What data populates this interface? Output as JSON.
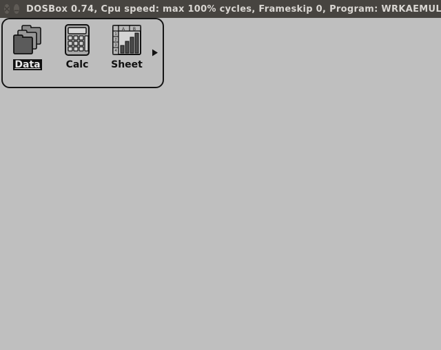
{
  "titlebar": {
    "text": "DOSBox 0.74, Cpu speed: max 100% cycles, Frameskip  0, Program: WRKAEMUL"
  },
  "panel": {
    "apps": [
      {
        "id": "data",
        "label": "Data",
        "icon": "folders-icon",
        "selected": true
      },
      {
        "id": "calc",
        "label": "Calc",
        "icon": "calculator-icon",
        "selected": false
      },
      {
        "id": "sheet",
        "label": "Sheet",
        "icon": "spreadsheet-icon",
        "selected": false
      }
    ],
    "scroll_right": "→"
  },
  "colors": {
    "desktop": "#bfbfbf",
    "panel_border": "#141414",
    "titlebar_bg": "#474440",
    "titlebar_fg": "#d9d6d2"
  }
}
